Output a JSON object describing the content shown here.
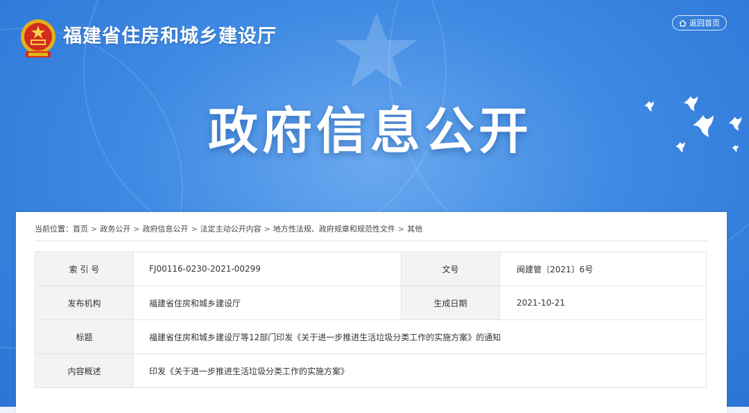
{
  "header": {
    "site_title": "福建省住房和城乡建设厅",
    "home_button_label": "返回首页",
    "hero_title": "政府信息公开"
  },
  "breadcrumb": {
    "prefix": "当前位置：",
    "items": [
      "首页",
      "政务公开",
      "政府信息公开",
      "法定主动公开内容",
      "地方性法规、政府规章和规范性文件",
      "其他"
    ],
    "separator": ">"
  },
  "info_table": {
    "index_label": "索 引 号",
    "index_value": "FJ00116-0230-2021-00299",
    "docno_label": "文号",
    "docno_value": "闽建管〔2021〕6号",
    "publisher_label": "发布机构",
    "publisher_value": "福建省住房和城乡建设厅",
    "date_label": "生成日期",
    "date_value": "2021-10-21",
    "title_label": "标题",
    "title_value": "福建省住房和城乡建设厅等12部门印发《关于进一步推进生活垃圾分类工作的实施方案》的通知",
    "summary_label": "内容概述",
    "summary_value": "印发《关于进一步推进生活垃圾分类工作的实施方案》"
  },
  "icons": [
    "national-emblem-icon",
    "home-icon",
    "dove-icon"
  ],
  "colors": {
    "banner_blue": "#3f8ae3",
    "label_bg": "#f3f3f3",
    "border": "#e3e3e3"
  }
}
